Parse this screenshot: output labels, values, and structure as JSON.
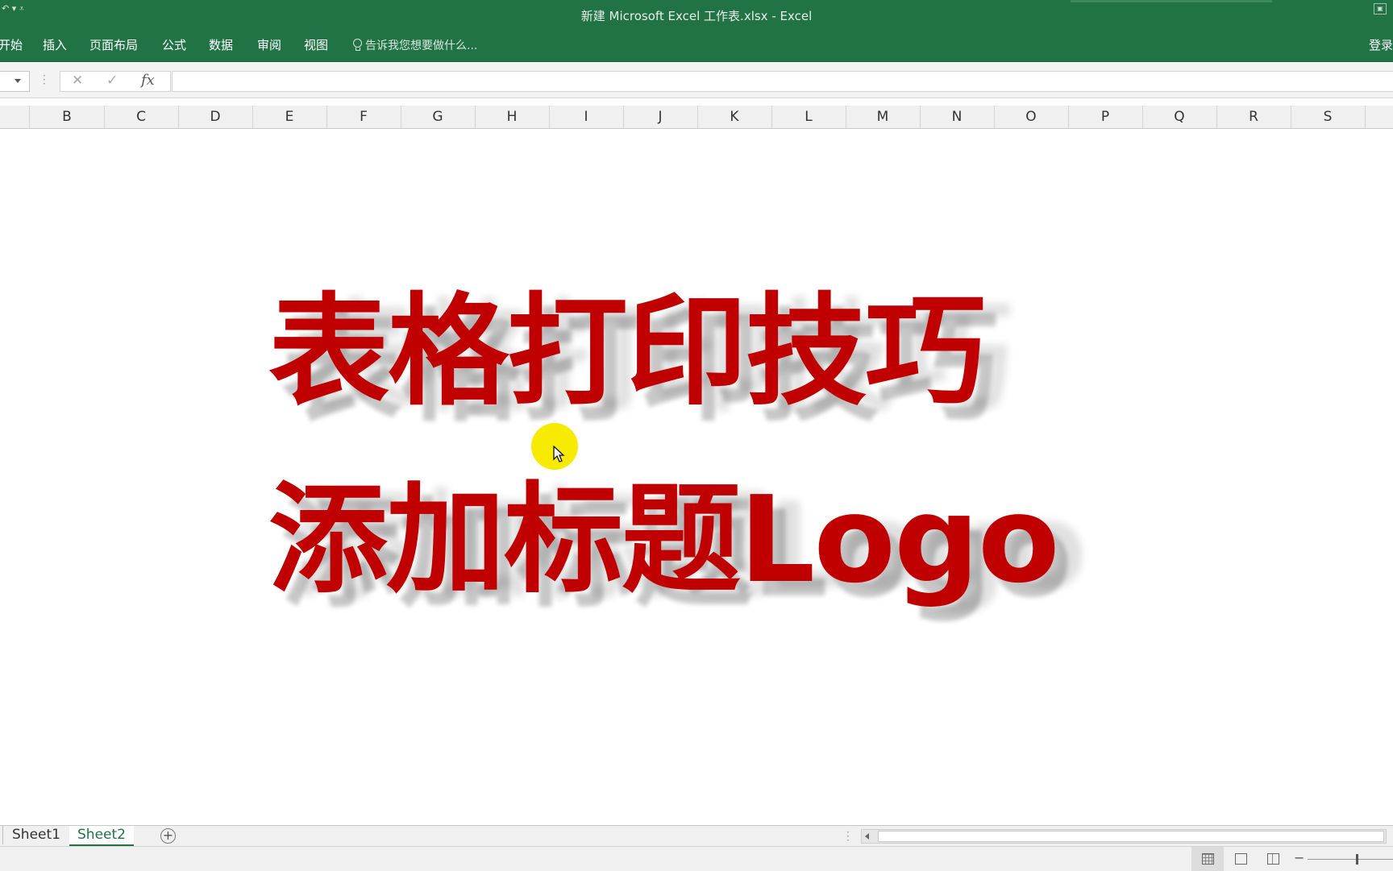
{
  "window": {
    "title": "新建 Microsoft Excel 工作表.xlsx - Excel",
    "qat_label": "↶ ▾  ⩡"
  },
  "ribbon": {
    "tabs": [
      "开始",
      "插入",
      "页面布局",
      "公式",
      "数据",
      "审阅",
      "视图"
    ],
    "tell_me": "告诉我您想要做什么...",
    "login": "登录"
  },
  "formula_bar": {
    "cancel_glyph": "✕",
    "enter_glyph": "✓",
    "fx_label": "fx",
    "value": ""
  },
  "columns": [
    "B",
    "C",
    "D",
    "E",
    "F",
    "G",
    "H",
    "I",
    "J",
    "K",
    "L",
    "M",
    "N",
    "O",
    "P",
    "Q",
    "R",
    "S"
  ],
  "content": {
    "headline_1": "表格打印技巧",
    "headline_2": "添加标题Logo"
  },
  "sheets": {
    "tabs": [
      "Sheet1",
      "Sheet2"
    ],
    "active": "Sheet2",
    "add_glyph": "+"
  },
  "colors": {
    "ribbon_green": "#217346",
    "headline_red": "#c00000",
    "cursor_highlight": "#f5ea00"
  },
  "icons": [
    "lightbulb-icon",
    "cancel-icon",
    "enter-icon",
    "fx-icon",
    "add-sheet-icon",
    "cursor-icon",
    "normal-view-icon",
    "page-layout-icon",
    "page-break-icon"
  ]
}
